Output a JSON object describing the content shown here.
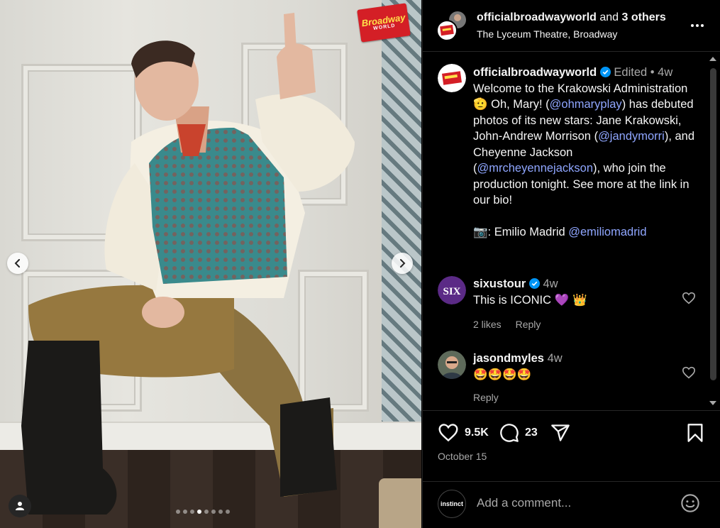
{
  "photo": {
    "logo_top": "Broadway",
    "logo_bottom": "WORLD",
    "dot_count": 8,
    "active_dot": 4
  },
  "header": {
    "username": "officialbroadwayworld",
    "and_text": "and",
    "others": "3 others",
    "location": "The Lyceum Theatre, Broadway"
  },
  "caption": {
    "username": "officialbroadwayworld",
    "edited": "Edited",
    "separator": "•",
    "time": "4w",
    "t1": "Welcome to the Krakowski Administration ",
    "emoji1": "🫡",
    "t2": " Oh, Mary! (",
    "m1": "@ohmaryplay",
    "t3": ") has debuted photos of its new stars: Jane Krakowski, John-Andrew Morrison (",
    "m2": "@jandymorri",
    "t4": "), and Cheyenne Jackson (",
    "m3": "@mrcheyennejackson",
    "t5": "), who join the production tonight. See more at the link in our bio!",
    "camera": "📷",
    "credit": ": Emilio Madrid ",
    "m4": "@emiliomadrid"
  },
  "comments": [
    {
      "username": "sixustour",
      "time": "4w",
      "text": "This is ICONIC ",
      "emojis": "💜 👑",
      "likes": "2 likes",
      "reply": "Reply",
      "avatar_text": "SIX"
    },
    {
      "username": "jasondmyles",
      "time": "4w",
      "emojis": "🤩🤩🤩🤩",
      "reply": "Reply"
    }
  ],
  "actions": {
    "likes": "9.5K",
    "comments": "23",
    "date": "October 15"
  },
  "add_comment": {
    "placeholder": "Add a comment...",
    "avatar_text": "instinct"
  },
  "colors": {
    "background": "#000000",
    "text": "#f5f5f5",
    "muted": "#a8a8a8",
    "mention": "#8fa6ff",
    "verified": "#0095f6",
    "divider": "#262626"
  }
}
